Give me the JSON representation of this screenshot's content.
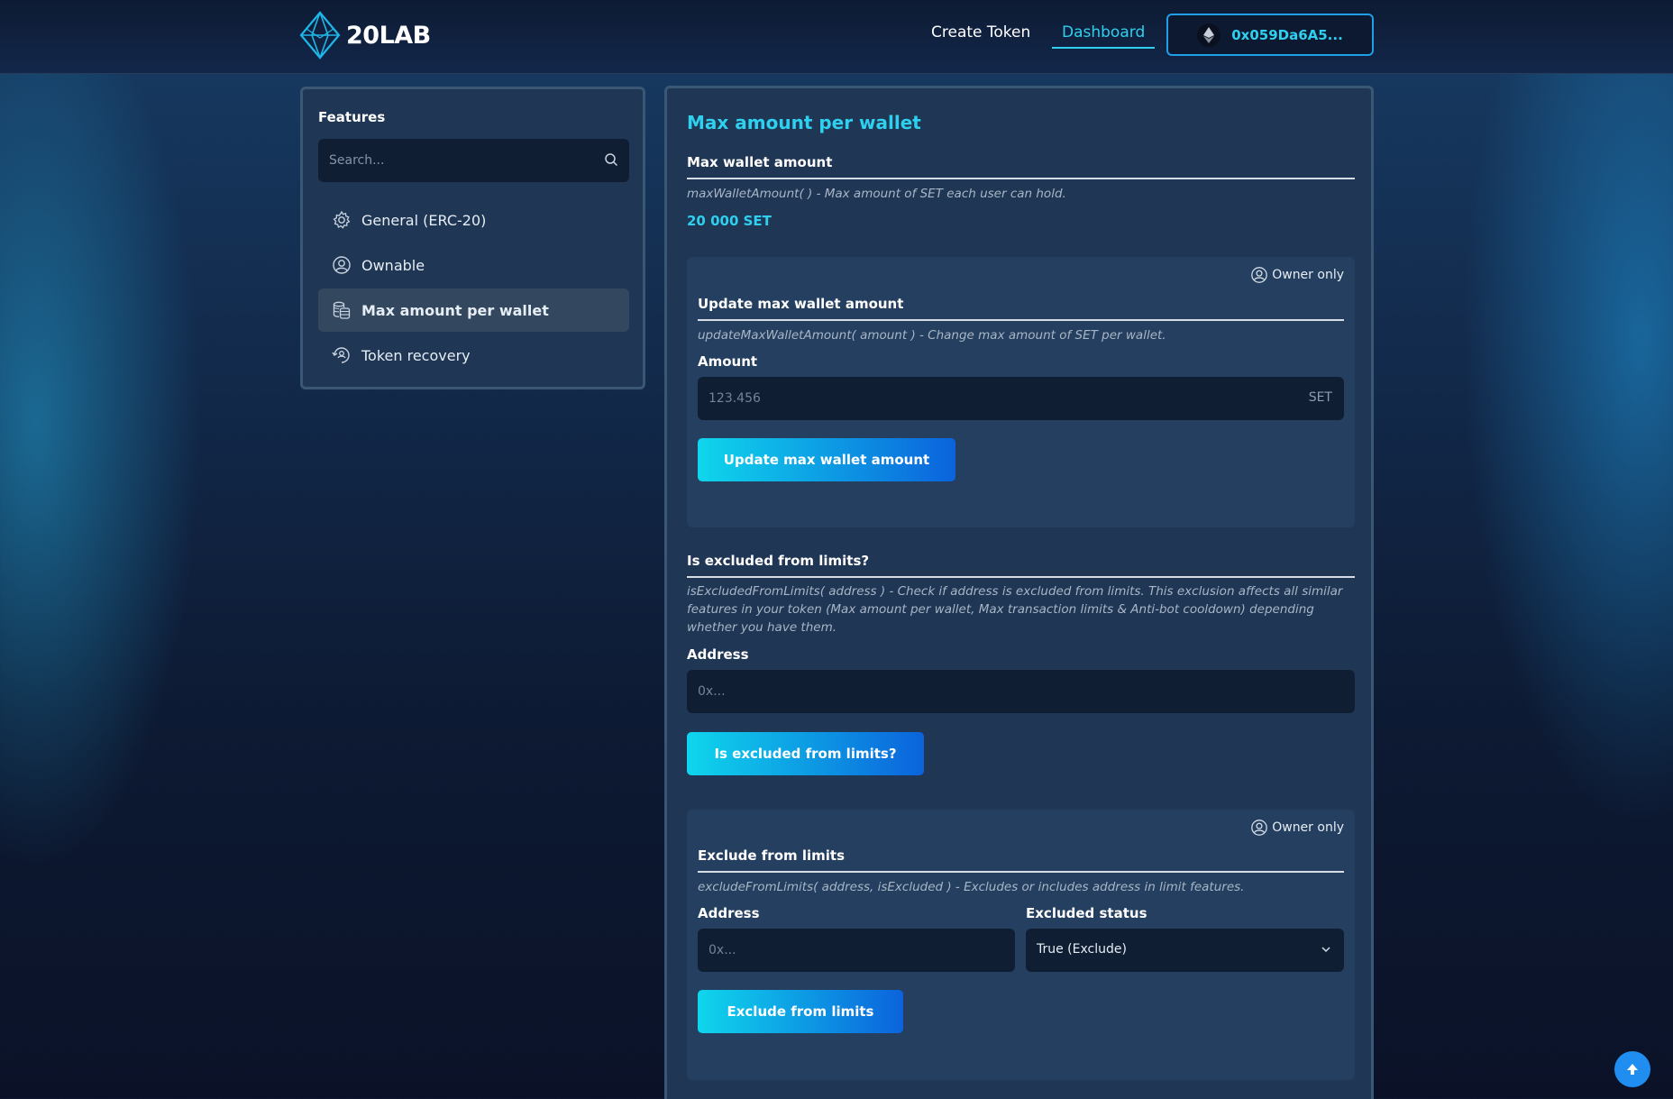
{
  "header": {
    "logo_text": "20LAB",
    "nav": {
      "create_token": "Create Token",
      "dashboard": "Dashboard"
    },
    "wallet_address": "0x059Da6A5..."
  },
  "sidebar": {
    "title": "Features",
    "search_placeholder": "Search...",
    "items": [
      {
        "label": "General (ERC-20)",
        "icon": "gear-icon"
      },
      {
        "label": "Ownable",
        "icon": "user-circle-icon"
      },
      {
        "label": "Max amount per wallet",
        "icon": "coins-stack-icon",
        "active": true
      },
      {
        "label": "Token recovery",
        "icon": "recovery-icon"
      }
    ]
  },
  "main": {
    "title": "Max amount per wallet",
    "max_wallet": {
      "heading": "Max wallet amount",
      "description": "maxWalletAmount( ) - Max amount of SET each user can hold.",
      "value": "20 000 SET"
    },
    "update": {
      "owner_badge": "Owner only",
      "heading": "Update max wallet amount",
      "description": "updateMaxWalletAmount( amount ) - Change max amount of SET per wallet.",
      "amount_label": "Amount",
      "amount_placeholder": "123.456",
      "amount_suffix": "SET",
      "button": "Update max wallet amount"
    },
    "is_excluded": {
      "heading": "Is excluded from limits?",
      "description": "isExcludedFromLimits( address ) - Check if address is excluded from limits. This exclusion affects all similar features in your token (Max amount per wallet, Max transaction limits & Anti-bot cooldown) depending whether you have them.",
      "address_label": "Address",
      "address_placeholder": "0x...",
      "button": "Is excluded from limits?"
    },
    "exclude": {
      "owner_badge": "Owner only",
      "heading": "Exclude from limits",
      "description": "excludeFromLimits( address, isExcluded ) - Excludes or includes address in limit features.",
      "address_label": "Address",
      "address_placeholder": "0x...",
      "status_label": "Excluded status",
      "status_value": "True (Exclude)",
      "button": "Exclude from limits"
    }
  },
  "colors": {
    "accent": "#2fd0ef",
    "panel": "#1f3654",
    "card": "#243f5f",
    "input": "#101e33"
  }
}
